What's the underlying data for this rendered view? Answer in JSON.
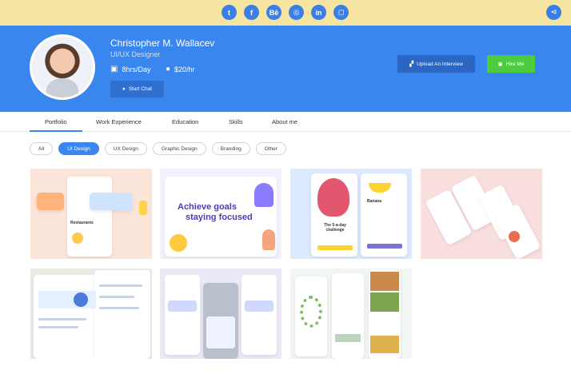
{
  "social": {
    "icons": [
      "twitter-icon",
      "facebook-icon",
      "behance-icon",
      "dribbble-icon",
      "linkedin-icon",
      "instagram-icon"
    ],
    "glyphs": [
      "t",
      "f",
      "Bē",
      "◎",
      "in",
      "◻"
    ],
    "share_icon": "share-icon",
    "share_glyph": "⋖"
  },
  "profile": {
    "name": "Christopher M. Wallacev",
    "role": "UI/UX Designer",
    "hours": "8hrs/Day",
    "rate": "$20/hr",
    "chat_button": "Start Chat",
    "upload_button": "Upload An Interview",
    "hire_button": "Hire Me"
  },
  "tabs": [
    "Portfolio",
    "Work Experience",
    "Education",
    "Skills",
    "About me"
  ],
  "filters": [
    "All",
    "UI Design",
    "UX Design",
    "Graphic Design",
    "Branding",
    "Other"
  ],
  "portfolio": {
    "thumb2_line1": "Achieve goals",
    "thumb2_line2": "staying focused",
    "thumb1_label": "Restaurants",
    "thumb3_label": "The 5-a-day challenge",
    "thumb3_fruit": "Banana"
  },
  "colors": {
    "topbar": "#f6e5a0",
    "hero": "#3a86ef",
    "hire": "#4dcc3f",
    "upload": "#2a66c2"
  }
}
